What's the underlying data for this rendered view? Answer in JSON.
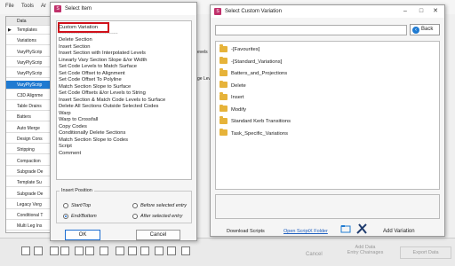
{
  "background_app": {
    "menu": [
      "File",
      "Tools",
      "Ar"
    ],
    "grid_header": "Data",
    "grid_rows": [
      "Templates",
      "Variations",
      "VaryPlyScrip",
      "VaryPlyScrip",
      "VaryPlyScrip",
      "VaryPlyScrip",
      "C3D Alignme",
      "Table Drains",
      "Batters",
      "Auto Merge",
      "Design Cons",
      "Stripping",
      "Compaction",
      "Subgrade De",
      "Template Su",
      "Subgrade De",
      "Legacy Verg",
      "Conditional T",
      "Multi Leg Ins"
    ],
    "grid_selected_index": 5,
    "side_fragment": "evels",
    "side_fragment2": "ge Levels",
    "bottom_buttons": {
      "cancel": "Cancel",
      "add_data_entry": "Add Data\nEntry Chainages",
      "export_data": "Export Data"
    }
  },
  "select_item": {
    "title": "Select Item",
    "items": [
      "Custom Variation",
      "Delete Section",
      "Insert Section",
      "Insert Section with Interpolated Levels",
      "Linearly Vary Section Slope &/or Width",
      "Set Code Levels to Match Surface",
      "Set Code Offset to Alignment",
      "Set Code Offset To Polyline",
      "Match Section Slope to Surface",
      "Set Code Offsets &/or Levels to String",
      "Insert Section & Match Code Levels to Surface",
      "Delete All Sections Outside Selected Codes",
      "Warp",
      "Warp to Crossfall",
      "Copy Codes",
      "Conditionally Delete Sections",
      "Match Section Slope to Codes",
      "Script",
      "Comment"
    ],
    "separator": "----------------------------------------",
    "insert_position": {
      "label": "Insert Position",
      "options": [
        "Start/Top",
        "End/Bottom",
        "Before selected entry",
        "After selected entry"
      ],
      "selected": "End/Bottom"
    },
    "ok": "OK",
    "cancel": "Cancel"
  },
  "custom_variation": {
    "title": "Select Custom Variation",
    "search_value": "",
    "back": "Back",
    "folders": [
      "-[Favourites]",
      "-[Standard_Variations]",
      "Batters_and_Projections",
      "Delete",
      "Insert",
      "Modify",
      "Standard Kerb Transitions",
      "Task_Specific_Variations"
    ],
    "download_scripts": "Download Scripts",
    "open_folder": "Open ScriptX Folder",
    "add_variation": "Add Variation",
    "accent_color": "#1f7ad1"
  }
}
